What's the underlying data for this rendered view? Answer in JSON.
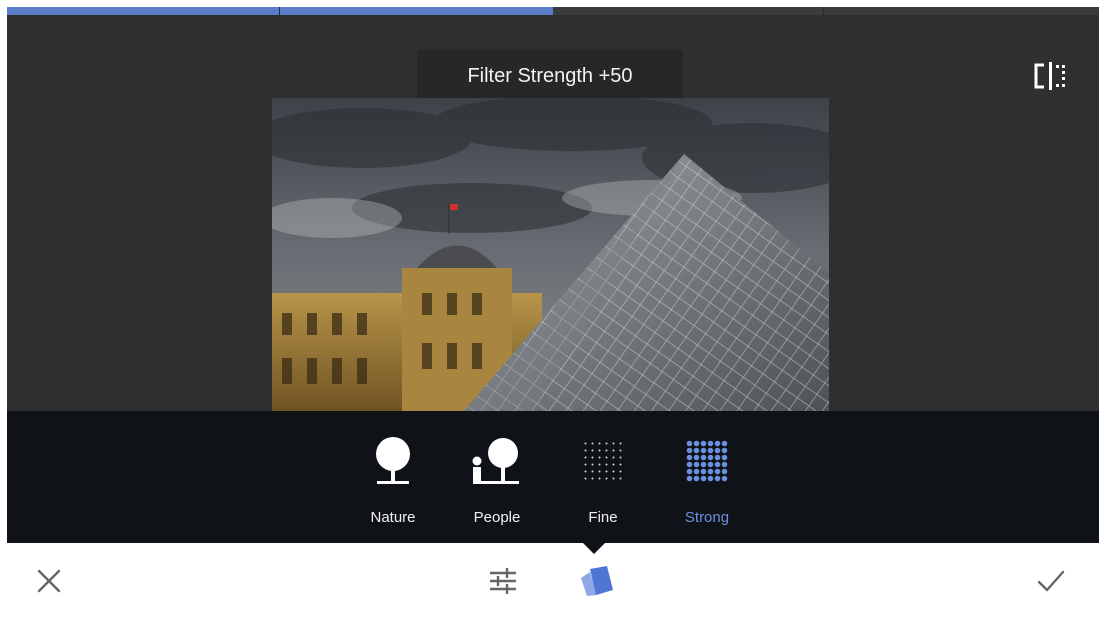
{
  "progress": {
    "fraction": 0.5
  },
  "tooltip": {
    "text": "Filter Strength +50"
  },
  "icons": {
    "compare": "compare-split-icon",
    "cancel": "close-icon",
    "adjust": "sliders-tune-icon",
    "styles": "style-cards-icon",
    "apply": "checkmark-icon"
  },
  "filters": [
    {
      "label": "Nature",
      "icon": "tree-icon",
      "selected": false
    },
    {
      "label": "People",
      "icon": "person-tree-icon",
      "selected": false
    },
    {
      "label": "Fine",
      "icon": "fine-dots-icon",
      "selected": false
    },
    {
      "label": "Strong",
      "icon": "strong-dots-icon",
      "selected": true
    }
  ],
  "colors": {
    "accent": "#5b7cc9",
    "selected_label": "#6b8fdf",
    "panel": "#0f1217",
    "background": "#2e2f30"
  }
}
